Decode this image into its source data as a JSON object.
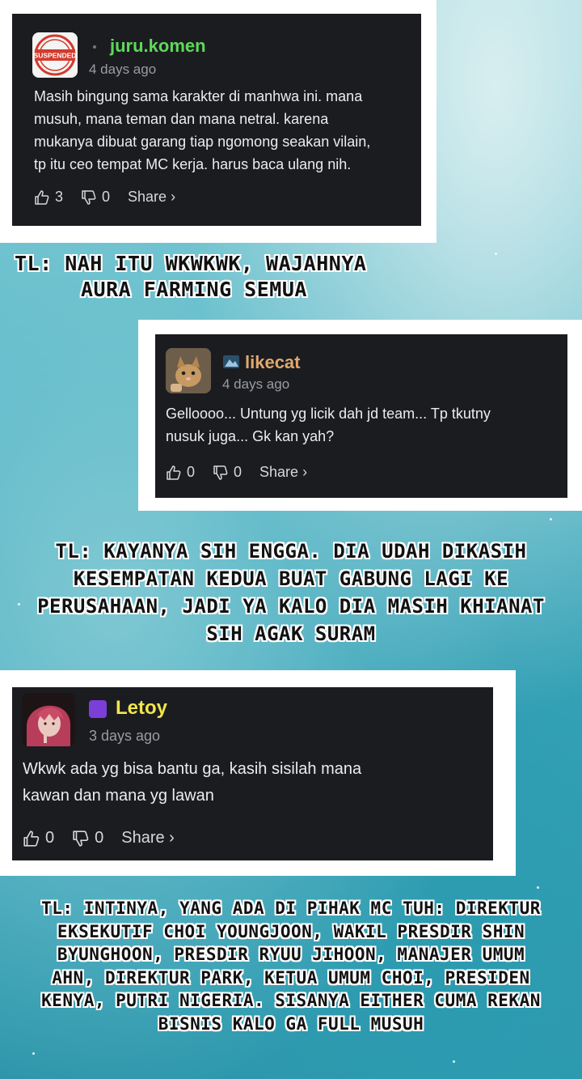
{
  "comments": [
    {
      "username": "juru.komen",
      "username_color": "#5fd85a",
      "badge_icon": "dot-badge",
      "avatar_label": "SUSPENDED",
      "time": "4 days ago",
      "lines": [
        "Masih bingung sama karakter di manhwa ini. mana",
        "musuh, mana teman dan mana netral. karena",
        "mukanya dibuat garang tiap ngomong seakan vilain,",
        "tp itu ceo tempat MC kerja. harus baca ulang nih."
      ],
      "likes": "3",
      "dislikes": "0",
      "share": "Share ›"
    },
    {
      "username": "likecat",
      "username_color": "#e0a86c",
      "badge_icon": "mountain-badge-icon",
      "avatar_icon": "cat-avatar",
      "time": "4 days ago",
      "lines": [
        "Gelloooo... Untung yg licik dah jd team... Tp tkutny",
        "nusuk juga... Gk kan yah?"
      ],
      "likes": "0",
      "dislikes": "0",
      "share": "Share ›"
    },
    {
      "username": "Letoy",
      "username_color": "#f2e64a",
      "badge_icon": "purple-badge-icon",
      "avatar_icon": "anime-avatar",
      "time": "3 days ago",
      "lines": [
        "Wkwk ada yg bisa bantu ga, kasih sisilah mana",
        "kawan dan mana yg lawan"
      ],
      "likes": "0",
      "dislikes": "0",
      "share": "Share ›"
    }
  ],
  "tl": [
    [
      "TL: NAH ITU WKWKWK, WAJAHNYA",
      "AURA FARMING SEMUA"
    ],
    [
      "TL: KAYANYA SIH ENGGA. DIA UDAH DIKASIH",
      "KESEMPATAN KEDUA BUAT GABUNG LAGI KE",
      "PERUSAHAAN, JADI YA KALO DIA MASIH KHIANAT",
      "SIH AGAK SURAM"
    ],
    [
      "TL: INTINYA, YANG ADA DI PIHAK MC TUH: DIREKTUR",
      "EKSEKUTIF CHOI YOUNGJOON, WAKIL PRESDIR SHIN",
      "BYUNGHOON, PRESDIR RYUU JIHOON, MANAJER UMUM",
      "AHN, DIREKTUR PARK, KETUA UMUM CHOI, PRESIDEN",
      "KENYA, PUTRI NIGERIA. SISANYA EITHER CUMA REKAN",
      "BISNIS KALO GA FULL MUSUH"
    ]
  ]
}
